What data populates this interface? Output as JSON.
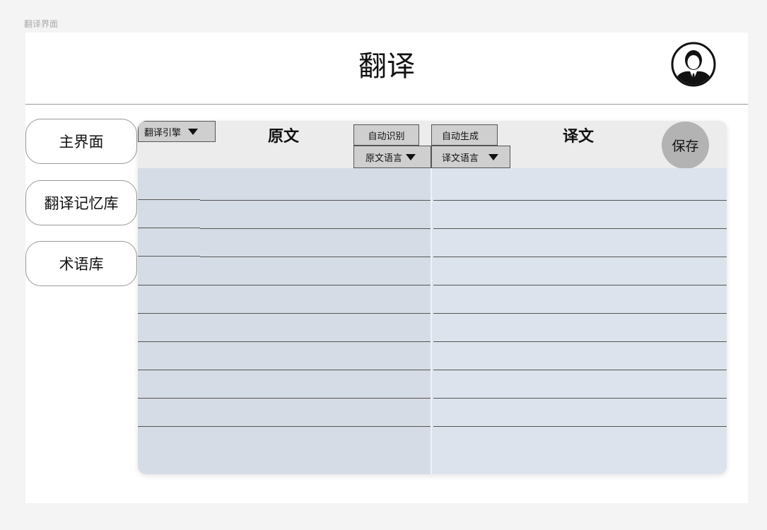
{
  "page_label": "翻译界面",
  "header": {
    "title": "翻译",
    "avatar_icon": "user-avatar-icon"
  },
  "sidebar": {
    "items": [
      {
        "label": "主界面"
      },
      {
        "label": "翻译记忆库"
      },
      {
        "label": "术语库"
      }
    ]
  },
  "toolbar": {
    "engine_label": "翻译引擎",
    "source_title": "原文",
    "auto_detect_label": "自动识别",
    "source_lang_label": "原文语言",
    "auto_generate_label": "自动生成",
    "target_lang_label": "译文语言",
    "target_title": "译文",
    "save_label": "保存"
  },
  "colors": {
    "panel_left": "#d6dce5",
    "panel_right": "#dce3ec",
    "header_bg": "#ececec",
    "save_bg": "#b3b3b3"
  }
}
